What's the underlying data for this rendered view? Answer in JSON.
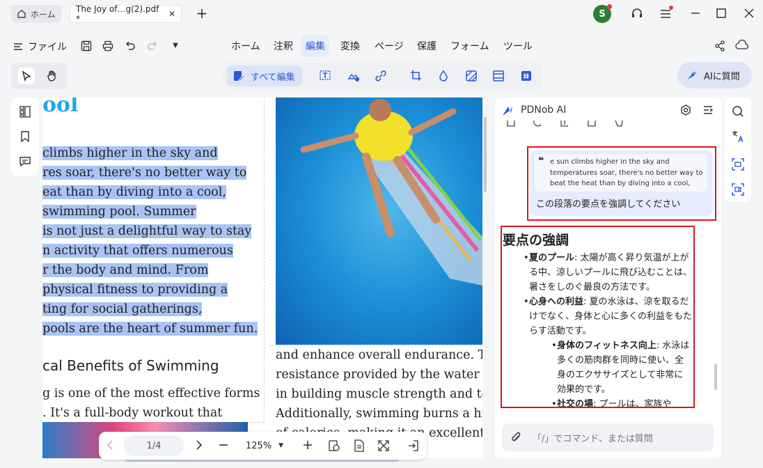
{
  "tabs": {
    "home": "ホーム",
    "doc": "The Joy of…g(2).pdf *"
  },
  "avatar": "S",
  "file_menu": "ファイル",
  "menus": [
    "ホーム",
    "注釈",
    "編集",
    "変換",
    "ページ",
    "保護",
    "フォーム",
    "ツール"
  ],
  "edit_all": "すべて編集",
  "ask_ai": "AIに質問",
  "doc": {
    "heading_fragment": "ool",
    "left_lines": [
      "climbs higher in the sky and",
      "res soar, there's no better way to",
      "eat than by diving into a cool,",
      "swimming pool. Summer",
      "is not just a delightful way to stay",
      "n activity that offers numerous",
      "r the body and mind. From",
      "physical fitness to providing a",
      "ting for social gatherings,",
      "pools are the heart of summer fun."
    ],
    "subheading": "cal Benefits of Swimming",
    "left_lines2": [
      "g is one of the most effective forms",
      ". It's a full-body workout that"
    ],
    "right_lines": [
      "and enhance overall endurance. Th",
      "resistance provided by the water al",
      "in building muscle strength and tor",
      "Additionally, swimming burns a hig",
      "of calories, making it an excellent ex"
    ]
  },
  "bottombar": {
    "page": "1/4",
    "zoom": "125%"
  },
  "ai": {
    "title": "PDNob AI",
    "quote": "e sun climbs higher in the sky and temperatures soar, there's no better way to beat the heat than by diving into a cool, refr…",
    "prompt": "この段落の要点を強調してください",
    "response_title": "要点の強調",
    "bullets": [
      {
        "bold": "夏のプール",
        "text": ": 太陽が高く昇り気温が上がる中、涼しいプールに飛び込むことは、暑さをしのぐ最良の方法です。"
      },
      {
        "bold": "心身への利益",
        "text": ": 夏の水泳は、涼を取るだけでなく、身体と心に多くの利益をもたらす活動です。"
      }
    ],
    "sub_bullet": {
      "bold": "身体のフィットネス向上",
      "text": ": 水泳は多くの筋肉群を同時に使い、全身のエクササイズとして非常に効果的です。"
    },
    "sub_bullet_cut": {
      "bold": "社交の場",
      "text": ": プールは、家族や"
    },
    "input_placeholder": "「/」でコマンド、または質問"
  },
  "colors": {
    "accent": "#2a5bd7",
    "highlight": "#a9c3f5",
    "heading": "#1fa9e6",
    "red": "#e0131c"
  }
}
